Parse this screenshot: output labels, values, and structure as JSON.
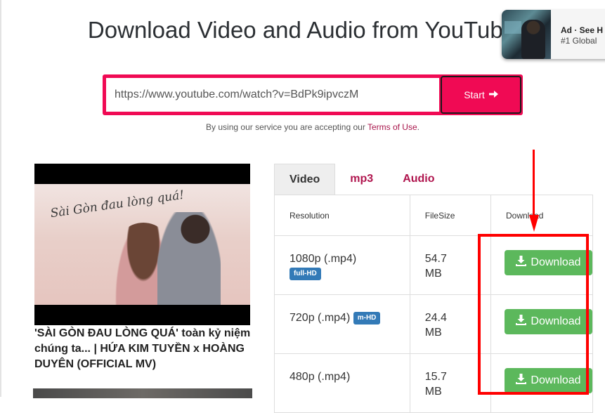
{
  "header": {
    "title": "Download Video and Audio from YouTube"
  },
  "ad": {
    "label": "Ad · See H",
    "subtitle": "#1 Global"
  },
  "search": {
    "value": "https://www.youtube.com/watch?v=BdPk9ipvczM",
    "placeholder": "",
    "start_label": "Start",
    "start_icon": "arrow-right-icon"
  },
  "terms": {
    "prefix": "By using our service you are accepting our ",
    "link": "Terms of Use",
    "suffix": "."
  },
  "video": {
    "thumbnail_text": "Sài Gòn đau lòng quá!",
    "title": "'SÀI GÒN ĐAU LÒNG QUÁ' toàn kỷ niệm chúng ta... | HỨA KIM TUYỀN x HOÀNG DUYÊN (OFFICIAL MV)"
  },
  "tabs": [
    {
      "label": "Video",
      "active": true
    },
    {
      "label": "mp3",
      "active": false
    },
    {
      "label": "Audio",
      "active": false
    }
  ],
  "table": {
    "headers": [
      "Resolution",
      "FileSize",
      "Download"
    ],
    "rows": [
      {
        "resolution": "1080p (.mp4)",
        "badge": "full-HD",
        "size_value": "54.7",
        "size_unit": "MB",
        "button": "Download"
      },
      {
        "resolution": "720p (.mp4)",
        "badge": "m-HD",
        "size_value": "24.4",
        "size_unit": "MB",
        "button": "Download"
      },
      {
        "resolution": "480p (.mp4)",
        "badge": "",
        "size_value": "15.7",
        "size_unit": "MB",
        "button": "Download"
      }
    ]
  },
  "colors": {
    "accent": "#f00a54",
    "link": "#a8144a",
    "download_button": "#5cb85c",
    "badge": "#337ab7",
    "annotation": "#ff0000"
  }
}
